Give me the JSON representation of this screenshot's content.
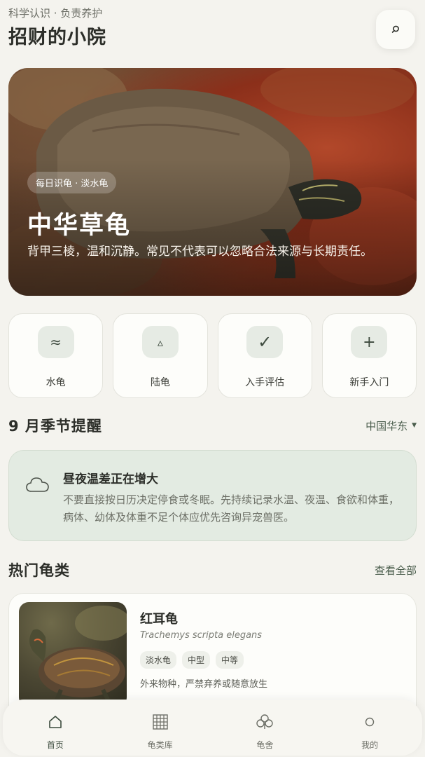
{
  "header": {
    "subtitle": "科学认识 · 负责养护",
    "title": "招财的小院"
  },
  "hero": {
    "chip": "每日识龟 · 淡水龟",
    "name": "中华草龟",
    "description": "背甲三棱，温和沉静。常见不代表可以忽略合法来源与长期责任。"
  },
  "categories": [
    {
      "label": "水龟",
      "icon": "≈"
    },
    {
      "label": "陆龟",
      "icon": "▵"
    },
    {
      "label": "入手评估",
      "icon": "✓"
    },
    {
      "label": "新手入门",
      "icon": "+"
    }
  ],
  "season": {
    "title": "9 月季节提醒",
    "region": "中国华东",
    "alert_title": "昼夜温差正在增大",
    "alert_text": "不要直接按日历决定停食或冬眠。先持续记录水温、夜温、食欲和体重，病体、幼体及体重不足个体应优先咨询异宠兽医。"
  },
  "popular": {
    "title": "热门龟类",
    "view_all": "查看全部",
    "items": [
      {
        "name": "红耳龟",
        "scientific": "Trachemys scripta elegans",
        "tags": [
          "淡水龟",
          "中型",
          "中等"
        ],
        "note": "外来物种，严禁弃养或随意放生"
      }
    ]
  },
  "tabs": [
    {
      "label": "首页",
      "icon": "home-icon",
      "active": true
    },
    {
      "label": "龟类库",
      "icon": "grid-icon",
      "active": false
    },
    {
      "label": "龟舍",
      "icon": "clover-icon",
      "active": false
    },
    {
      "label": "我的",
      "icon": "user-icon",
      "active": false
    }
  ],
  "colors": {
    "background": "#f4f3ee",
    "accent_green": "#4b5e4d",
    "alert_bg": "#e3ebe2"
  }
}
